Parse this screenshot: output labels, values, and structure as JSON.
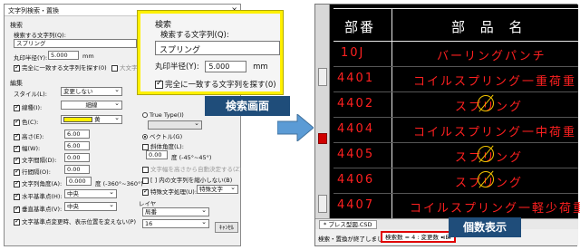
{
  "dialog": {
    "title": "文字列検索・置換",
    "search": {
      "section": "検索",
      "query_label": "検索する文字列(Q):",
      "query_value": "スプリング",
      "radius_label": "丸印半径(Y):",
      "radius_value": "5.000",
      "radius_unit": "mm",
      "exact_label": "完全に一致する文字列を探す(0)",
      "case_label": "大文字/小"
    },
    "edit": {
      "section": "編集",
      "style_label": "スタイル(L):",
      "style_value": "変更しない",
      "line_label": "線種(I):",
      "line_value": "細線",
      "color_label": "色(C):",
      "color_value": "黄",
      "height_label": "高さ(E):",
      "height_value": "6.00",
      "width_label": "幅(W):",
      "width_value": "6.00",
      "charspace_label": "文字間隔(D):",
      "charspace_value": "0.00",
      "linespace_label": "行間隔(O):",
      "linespace_value": "0.00",
      "angle_label": "文字列角度(A):",
      "angle_value": "0.000",
      "angle_hint": "度 (-360°~360°)",
      "halign_label": "水平基準点(H):",
      "halign_value": "中央",
      "valign_label": "垂直基準点(V):",
      "valign_value": "中央",
      "keep_label": "文字基準点変更時、表示位置を変えない(P)"
    },
    "font": {
      "truetype_label": "True Type(I)",
      "vector_label": "ベクトル(G)",
      "slant_label": "斜体角度(L):",
      "slant_value": "0.00",
      "slant_hint": "度 (-45°~45°)",
      "auto_label": "文字幅を高さから自動決定する(Z)",
      "shrink_label": "[ ] 内の文字列を縮小しない(B)",
      "special_label": "特殊文字処理(U):",
      "special_value": "特殊文字"
    },
    "layer": {
      "label": "レイヤ",
      "value": "局番",
      "sub_value": "16"
    },
    "partial_label_1": "置",
    "cancel_label": "ｷｬﾝｾﾙ"
  },
  "callout": {
    "section": "検索",
    "query_label": "検索する文字列(Q):",
    "query_value": "スプリング",
    "radius_label": "丸印半径(Y):",
    "radius_value": "5.000",
    "radius_unit": "mm",
    "exact_label": "完全に一致する文字列を探す(0)"
  },
  "labels": {
    "search_screen": "検索画面",
    "count_display": "個数表示"
  },
  "cad": {
    "header_code": "部番",
    "header_name": "部 品 名",
    "rows": [
      {
        "code": "10J",
        "name": "バーリングパンチ"
      },
      {
        "code": "4401",
        "name": "コイルスプリング一重荷重"
      },
      {
        "code": "4402",
        "name": "スプリング"
      },
      {
        "code": "4404",
        "name": "コイルスプリング一中荷重"
      },
      {
        "code": "4405",
        "name": "スプリング"
      },
      {
        "code": "4406",
        "name": "スプリング"
      },
      {
        "code": "4407",
        "name": "コイルスプリング一軽少荷重"
      }
    ],
    "tab_label": "* プレス型図.CSD",
    "status_msg": "検索・置換が終了しました",
    "status_count": "検索数 = 4 : 変更数 = 4",
    "status_rest": "<E"
  },
  "colors": {
    "highlight": "#fff000",
    "label_bg": "#1f4d7a",
    "cad_bg": "#000000",
    "cad_text": "#ff2020",
    "count_box": "#e00000",
    "arrow": "#5b9bd5"
  }
}
